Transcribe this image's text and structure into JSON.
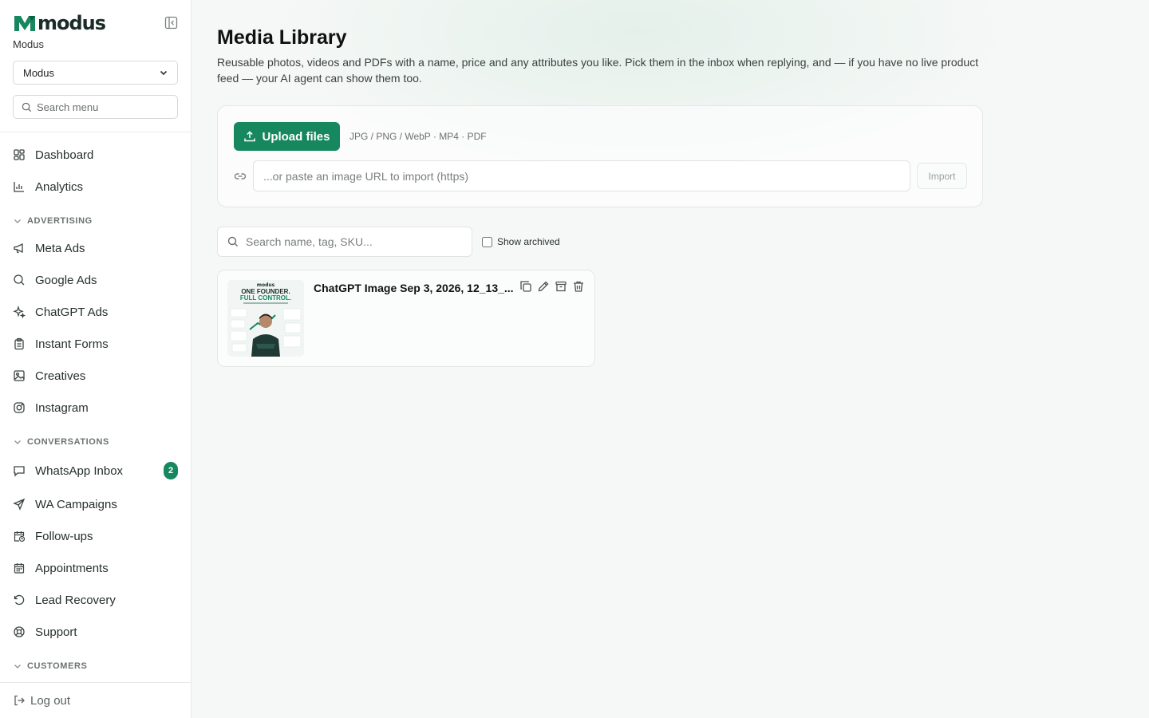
{
  "brand": {
    "name": "modus",
    "org_label": "Modus"
  },
  "org_select": {
    "value": "Modus"
  },
  "menu_search": {
    "placeholder": "Search menu"
  },
  "nav": {
    "dashboard": "Dashboard",
    "analytics": "Analytics",
    "advertising_head": "ADVERTISING",
    "meta_ads": "Meta Ads",
    "google_ads": "Google Ads",
    "chatgpt_ads": "ChatGPT Ads",
    "instant_forms": "Instant Forms",
    "creatives": "Creatives",
    "instagram": "Instagram",
    "conversations_head": "CONVERSATIONS",
    "whatsapp_inbox": "WhatsApp Inbox",
    "whatsapp_badge": "2",
    "wa_campaigns": "WA Campaigns",
    "follow_ups": "Follow-ups",
    "appointments": "Appointments",
    "lead_recovery": "Lead Recovery",
    "support": "Support",
    "customers_head": "CUSTOMERS",
    "logout": "Log out"
  },
  "page": {
    "title": "Media Library",
    "description": "Reusable photos, videos and PDFs with a name, price and any attributes you like. Pick them in the inbox when replying, and — if you have no live product feed — your AI agent can show them too."
  },
  "upload": {
    "button_label": "Upload files",
    "formats": "JPG / PNG / WebP · MP4 · PDF",
    "url_placeholder": "...or paste an image URL to import (https)",
    "import_label": "Import"
  },
  "library": {
    "search_placeholder": "Search name, tag, SKU...",
    "show_archived_label": "Show archived",
    "items": [
      {
        "name": "ChatGPT Image Sep 3, 2026, 12_13_...",
        "thumb_logo": "modus",
        "thumb_line1": "ONE FOUNDER.",
        "thumb_line2": "FULL CONTROL."
      }
    ]
  },
  "colors": {
    "accent": "#17875f",
    "brand_dark": "#1a2b28"
  }
}
